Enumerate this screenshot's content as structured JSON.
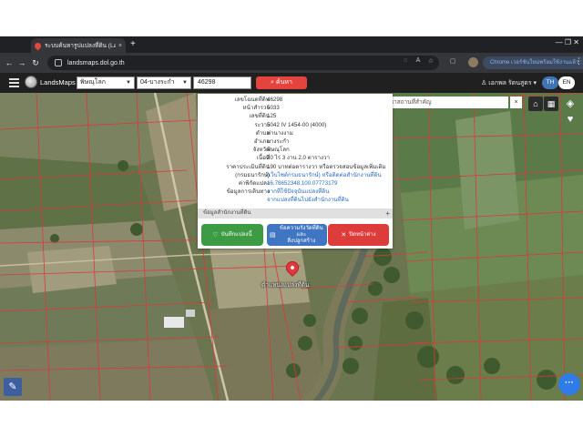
{
  "browser": {
    "tab_title": "ระบบค้นหารูปแปลงที่ดิน (Lands",
    "tab_close": "×",
    "new_tab": "+",
    "url": "landsmaps.dol.go.th",
    "update_button": "Chrome เวอร์ชันใหม่พร้อมใช้งานแล้ว :",
    "window_controls": "—  ❐  ✕"
  },
  "app": {
    "brand": "LandsMaps",
    "province_select": "พิษณุโลก",
    "district_select": "04-บางระกำ",
    "parcel_input": "46298",
    "search_button": "ค้นหา",
    "user_name": "เอกพล รัตนสูตร",
    "lang_th": "TH",
    "lang_en": "EN"
  },
  "map": {
    "search_placeholder": "ค้นหาสถานที่สำคัญ",
    "search_clear": "×",
    "pin_label": "ตำแหน่งแปลงที่ดิน"
  },
  "popup": {
    "rows": [
      {
        "key": "เลขโฉนดที่ดิน",
        "value": "46298"
      },
      {
        "key": "หน้าสำรวจ",
        "value": "5033"
      },
      {
        "key": "เลขที่ดิน",
        "value": "125"
      },
      {
        "key": "ระวาง",
        "value": "5042 IV 1454-00 (4000)"
      },
      {
        "key": "ตำบล",
        "value": "ท่านางงาม"
      },
      {
        "key": "อำเภอ",
        "value": "บางระกำ"
      },
      {
        "key": "จังหวัด",
        "value": "พิษณุโลก"
      },
      {
        "key": "เนื้อที่",
        "value": "20 ไร่ 3 งาน 2.0 ตารางวา"
      },
      {
        "key": "ราคาประเมินที่ดิน",
        "value": "190 บาทต่อตารางวา หรือตรวจสอบข้อมูลเพิ่มเติม"
      },
      {
        "key": "(กรมธนารักษ์)",
        "value": "(เว็บไซต์กรมธนารักษ์) หรือติดต่อสำนักงานที่ดิน"
      },
      {
        "key": "ค่าพิกัดแปลง",
        "value": "16.78652348,100.07773179"
      },
      {
        "key": "ข้อมูลการเดินทาง",
        "value": "จากที่ใช้ปัจจุบันแปลงที่ดิน"
      },
      {
        "key": "",
        "value": "จากแปลงที่ดินไปยังสำนักงานที่ดิน"
      }
    ],
    "office_bar": "ข้อมูลสำนักงานที่ดิน",
    "office_expand": "+",
    "save_button": "บันทึกแปลงนี้",
    "survey_button": "ข้อความรังวัดที่ดินและ\nสิ่งปลูกสร้าง",
    "close_button": "ปิดหน้าต่าง"
  },
  "icons": {
    "home": "home-icon",
    "grid": "grid-icon",
    "layers": "layers-icon",
    "favorite": "heart-icon",
    "measure": "measure-tool-icon",
    "more": "more-icon"
  },
  "colors": {
    "search_button": "#e4443d",
    "lang_active": "#3f74b5",
    "save": "#3d9b43",
    "survey": "#3f75c2",
    "close": "#de3b3b",
    "parcel_lines": "#d83a3a",
    "link": "#2a6bc4"
  }
}
